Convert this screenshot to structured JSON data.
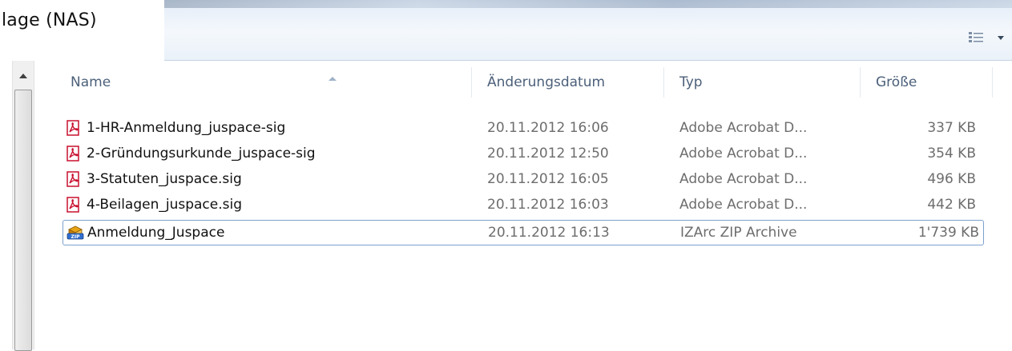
{
  "window": {
    "title_fragment": "lage (NAS)"
  },
  "toolbar": {
    "view_icon": "details-view-icon",
    "view_dropdown_icon": "chevron-down-icon"
  },
  "columns": {
    "name": "Name",
    "date": "Änderungsdatum",
    "type": "Typ",
    "size": "Größe",
    "sorted_by": "Name"
  },
  "files": [
    {
      "name": "1-HR-Anmeldung_juspace-sig",
      "date": "20.11.2012 16:06",
      "type": "Adobe Acrobat D...",
      "size": "337 KB",
      "icon": "pdf-icon"
    },
    {
      "name": "2-Gründungsurkunde_juspace-sig",
      "date": "20.11.2012 12:50",
      "type": "Adobe Acrobat D...",
      "size": "354 KB",
      "icon": "pdf-icon"
    },
    {
      "name": "3-Statuten_juspace.sig",
      "date": "20.11.2012 16:05",
      "type": "Adobe Acrobat D...",
      "size": "496 KB",
      "icon": "pdf-icon"
    },
    {
      "name": "4-Beilagen_juspace.sig",
      "date": "20.11.2012 16:03",
      "type": "Adobe Acrobat D...",
      "size": "442 KB",
      "icon": "pdf-icon"
    },
    {
      "name": "Anmeldung_Juspace",
      "date": "20.11.2012 16:13",
      "type": "IZArc ZIP Archive",
      "size": "1'739 KB",
      "icon": "zip-archive-icon",
      "selected": true
    }
  ],
  "colors": {
    "header_text": "#4c607a",
    "selection_border": "#7da2ce",
    "pdf_red": "#c8102e",
    "secondary_text": "#6d6d6d"
  }
}
